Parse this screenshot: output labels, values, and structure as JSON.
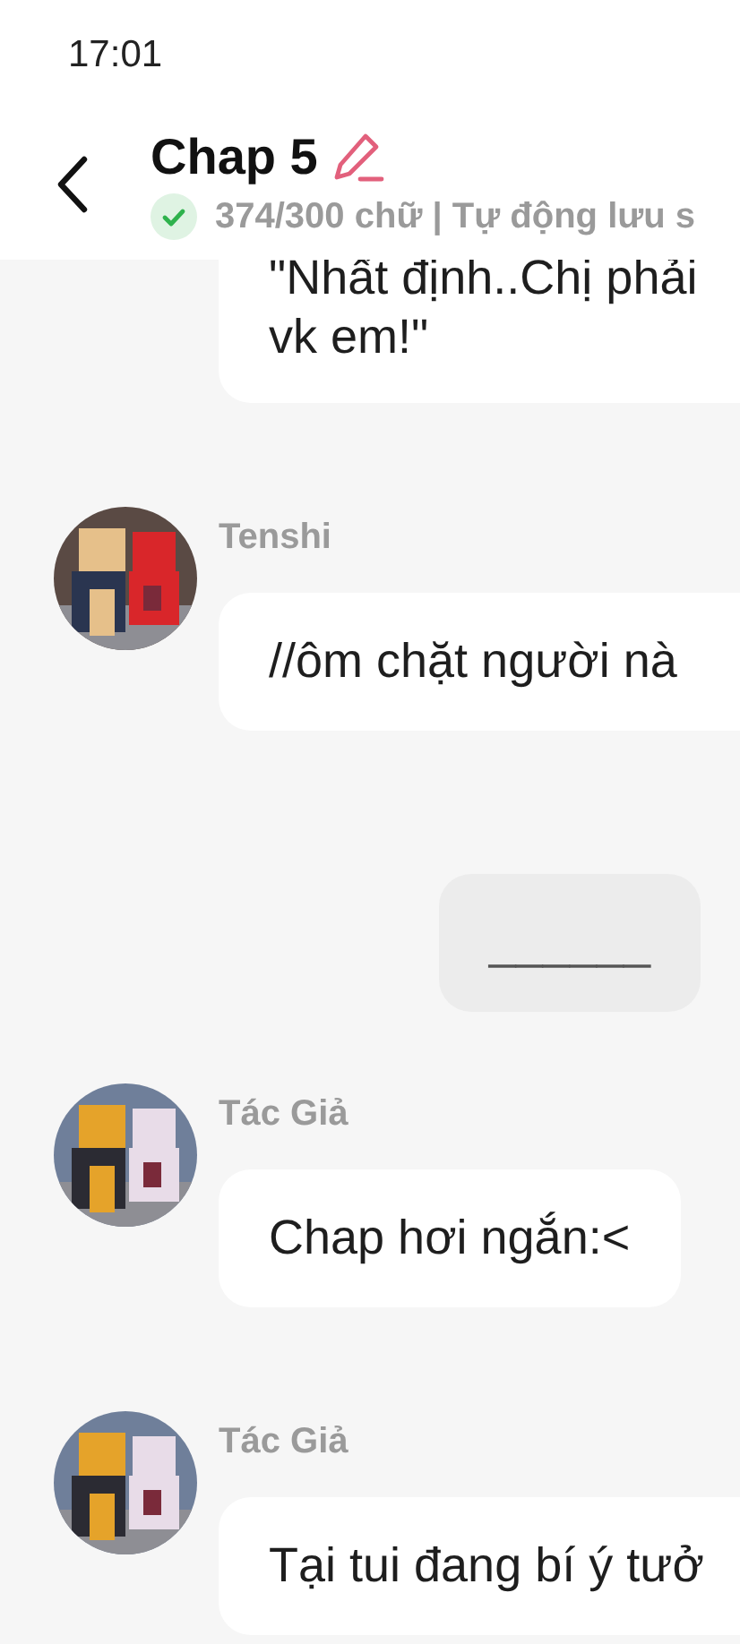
{
  "status_bar": {
    "time": "17:01"
  },
  "header": {
    "title": "Chap 5",
    "saved": true,
    "subtitle": "374/300 chữ | Tự động lưu s"
  },
  "messages": [
    {
      "kind": "incoming",
      "lines": [
        "\"Nhất định..Chị phải",
        "vk em!\""
      ]
    },
    {
      "kind": "incoming",
      "sender": "Tenshi",
      "avatar": {
        "kind": "picture"
      },
      "lines": [
        "//ôm chặt người nà"
      ]
    },
    {
      "kind": "outgoing",
      "lines": [
        "______"
      ]
    },
    {
      "kind": "incoming",
      "sender": "Tác Giả",
      "avatar": {
        "kind": "picture"
      },
      "lines": [
        "Chap hơi ngắn:<"
      ]
    },
    {
      "kind": "incoming",
      "sender": "Tác Giả",
      "avatar": {
        "kind": "picture"
      },
      "lines": [
        "Tại tui đang bí ý tưở"
      ]
    }
  ]
}
